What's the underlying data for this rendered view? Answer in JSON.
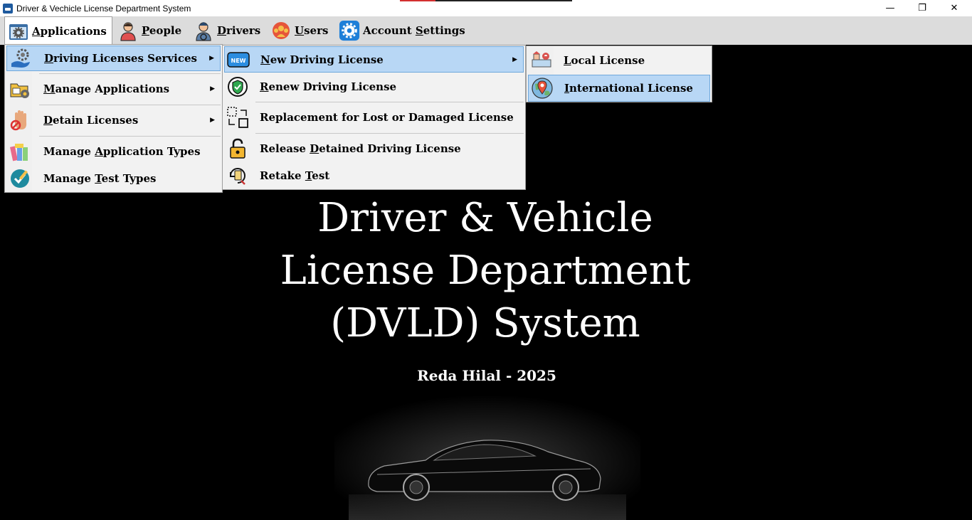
{
  "window": {
    "title": "Driver & Vechicle License Department System",
    "minimize_glyph": "—",
    "maximize_glyph": "❐",
    "close_glyph": "✕"
  },
  "menubar": {
    "items": [
      {
        "icon": "applications-gear-icon",
        "prefix": "",
        "accel": "A",
        "rest": "pplications"
      },
      {
        "icon": "person-icon",
        "prefix": "",
        "accel": "P",
        "rest": "eople"
      },
      {
        "icon": "driver-icon",
        "prefix": "",
        "accel": "D",
        "rest": "rivers"
      },
      {
        "icon": "users-icon",
        "prefix": "",
        "accel": "U",
        "rest": "sers"
      },
      {
        "icon": "settings-gear-icon",
        "prefix": "Account ",
        "accel": "S",
        "rest": "ettings"
      }
    ]
  },
  "applications_menu": {
    "items": [
      {
        "icon": "gear-hand-icon",
        "prefix": "",
        "accel": "D",
        "rest": "riving Licenses Services",
        "submenu": true
      },
      {
        "icon": "folder-gear-icon",
        "prefix": "",
        "accel": "M",
        "rest": "anage Applications",
        "submenu": true
      },
      {
        "icon": "stop-hand-icon",
        "prefix": "",
        "accel": "D",
        "rest": "etain Licenses",
        "submenu": true
      },
      {
        "icon": "books-icon",
        "prefix": "Manage ",
        "accel": "A",
        "rest": "pplication Types",
        "submenu": false
      },
      {
        "icon": "test-check-icon",
        "prefix": "Manage ",
        "accel": "T",
        "rest": "est Types",
        "submenu": false
      }
    ]
  },
  "services_menu": {
    "items": [
      {
        "icon": "new-badge-icon",
        "prefix": "",
        "accel": "N",
        "rest": "ew Driving License",
        "submenu": true,
        "badge": "NEW"
      },
      {
        "icon": "shield-check-icon",
        "prefix": "",
        "accel": "R",
        "rest": "enew Driving License",
        "submenu": false
      },
      {
        "icon": "replace-icon",
        "prefix": "Replacement for Lost or Damaged License",
        "accel": "",
        "rest": "",
        "submenu": false
      },
      {
        "icon": "unlock-icon",
        "prefix": "Release ",
        "accel": "D",
        "rest": "etained Driving License",
        "submenu": false
      },
      {
        "icon": "retake-icon",
        "prefix": "Retake ",
        "accel": "T",
        "rest": "est",
        "submenu": false
      }
    ]
  },
  "new_license_menu": {
    "items": [
      {
        "icon": "local-map-icon",
        "prefix": "",
        "accel": "L",
        "rest": "ocal License"
      },
      {
        "icon": "globe-pin-icon",
        "prefix": "",
        "accel": "I",
        "rest": "nternational License"
      }
    ]
  },
  "splash": {
    "line1": "Driver & Vehicle",
    "line2": "License Department",
    "line3": "(DVLD) System",
    "author": "Reda Hilal - 2025"
  },
  "colors": {
    "highlight": "#b8d7f5",
    "highlight_border": "#6fa8dc",
    "menubar_bg": "#dcdcdc",
    "background": "#000000"
  }
}
